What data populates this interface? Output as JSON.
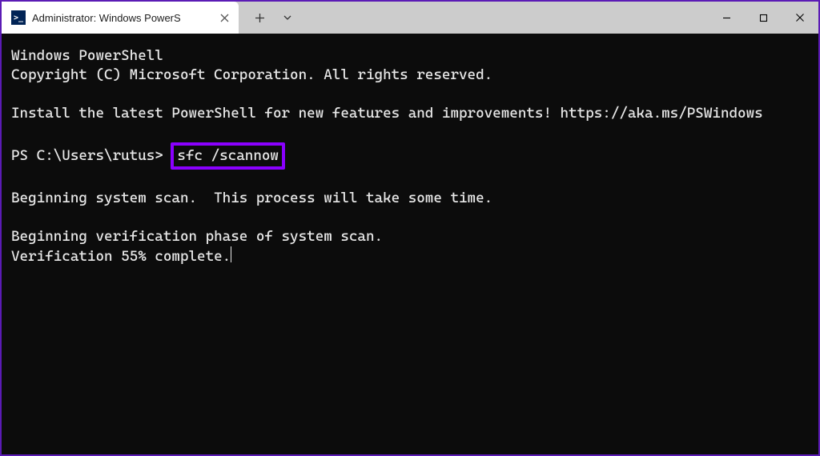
{
  "titlebar": {
    "tab_title": "Administrator: Windows PowerS",
    "tab_icon_glyph": ">_"
  },
  "terminal": {
    "header_line1": "Windows PowerShell",
    "header_line2": "Copyright (C) Microsoft Corporation. All rights reserved.",
    "install_line": "Install the latest PowerShell for new features and improvements! https://aka.ms/PSWindows",
    "prompt_prefix": "PS C:\\Users\\rutus> ",
    "command": "sfc /scannow",
    "output1": "Beginning system scan.  This process will take some time.",
    "output2": "Beginning verification phase of system scan.",
    "output3": "Verification 55% complete."
  }
}
